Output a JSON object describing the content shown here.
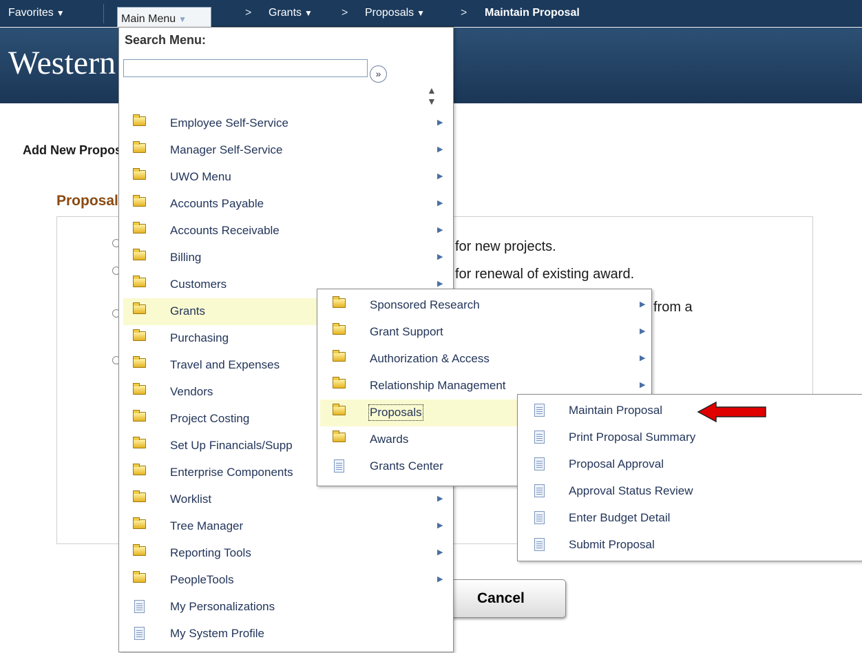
{
  "topbar": {
    "favorites": "Favorites",
    "main_menu": "Main Menu",
    "breadcrumb_sep": ">",
    "breadcrumbs": [
      "Grants",
      "Proposals",
      "Maintain Proposal"
    ]
  },
  "header": {
    "logo_text": "Western"
  },
  "page": {
    "title": "Add New Proposal",
    "section_title": "Proposal",
    "options": [
      "for new projects.",
      "for renewal of existing award.",
      "from a"
    ],
    "cancel_label": "Cancel"
  },
  "main_menu": {
    "search_label": "Search Menu:",
    "search_value": "",
    "items": [
      {
        "label": "Employee Self-Service",
        "type": "folder"
      },
      {
        "label": "Manager Self-Service",
        "type": "folder"
      },
      {
        "label": "UWO Menu",
        "type": "folder"
      },
      {
        "label": "Accounts Payable",
        "type": "folder"
      },
      {
        "label": "Accounts Receivable",
        "type": "folder"
      },
      {
        "label": "Billing",
        "type": "folder"
      },
      {
        "label": "Customers",
        "type": "folder"
      },
      {
        "label": "Grants",
        "type": "folder",
        "highlighted": true
      },
      {
        "label": "Purchasing",
        "type": "folder"
      },
      {
        "label": "Travel and Expenses",
        "type": "folder"
      },
      {
        "label": "Vendors",
        "type": "folder"
      },
      {
        "label": "Project Costing",
        "type": "folder"
      },
      {
        "label": "Set Up Financials/Supp",
        "type": "folder"
      },
      {
        "label": "Enterprise Components",
        "type": "folder"
      },
      {
        "label": "Worklist",
        "type": "folder"
      },
      {
        "label": "Tree Manager",
        "type": "folder"
      },
      {
        "label": "Reporting Tools",
        "type": "folder"
      },
      {
        "label": "PeopleTools",
        "type": "folder"
      },
      {
        "label": "My Personalizations",
        "type": "page"
      },
      {
        "label": "My System Profile",
        "type": "page"
      }
    ]
  },
  "grants_menu": {
    "items": [
      {
        "label": "Sponsored Research",
        "type": "folder"
      },
      {
        "label": "Grant Support",
        "type": "folder"
      },
      {
        "label": "Authorization & Access",
        "type": "folder"
      },
      {
        "label": "Relationship Management",
        "type": "folder"
      },
      {
        "label": "Proposals",
        "type": "folder",
        "highlighted": true
      },
      {
        "label": "Awards",
        "type": "folder"
      },
      {
        "label": "Grants Center",
        "type": "page"
      }
    ]
  },
  "proposals_menu": {
    "items": [
      {
        "label": "Maintain Proposal"
      },
      {
        "label": "Print Proposal Summary"
      },
      {
        "label": "Proposal Approval"
      },
      {
        "label": "Approval Status Review"
      },
      {
        "label": "Enter Budget Detail"
      },
      {
        "label": "Submit Proposal"
      }
    ]
  },
  "colors": {
    "topbar": "#1b3a5c",
    "header": "#2c5074",
    "section_title": "#8a4a12",
    "menu_highlight": "#fafad0",
    "menu_text": "#23355a",
    "annotation_arrow": "#e00000"
  }
}
